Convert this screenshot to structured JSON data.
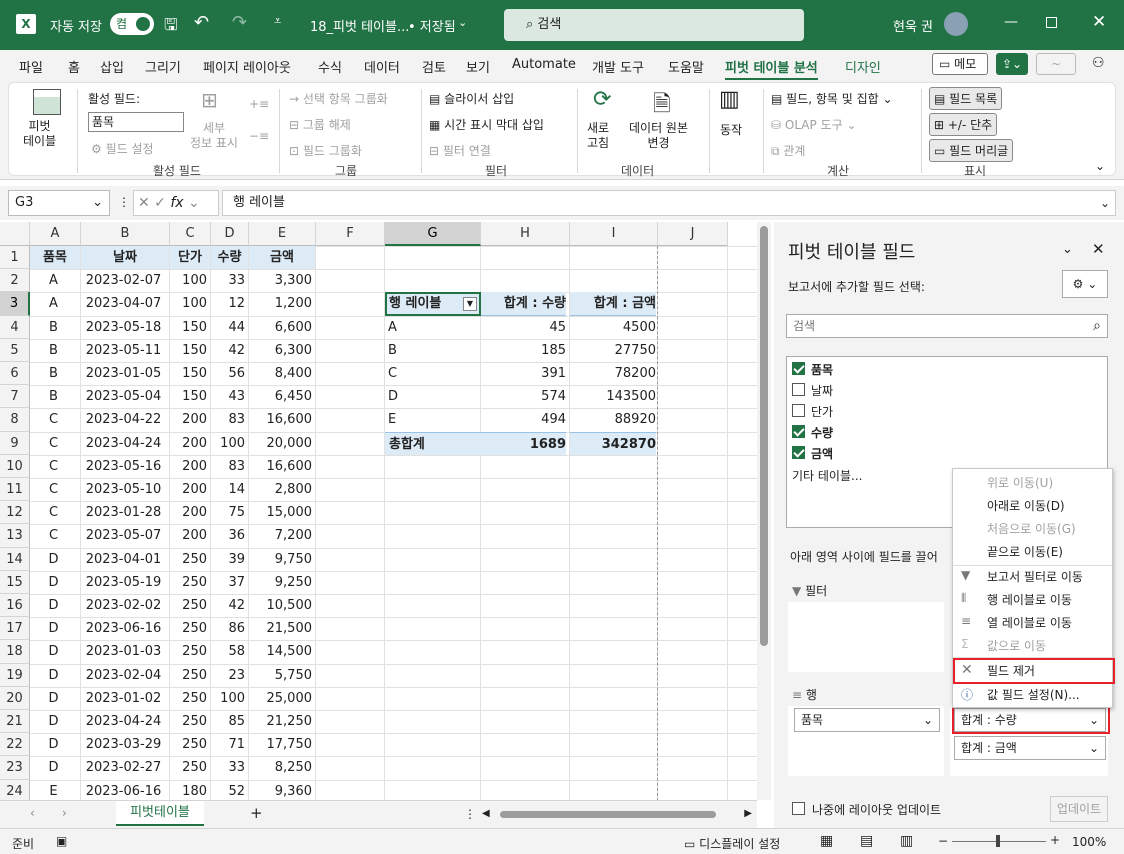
{
  "titlebar": {
    "autosave": "자동 저장",
    "toggle": "켬",
    "filename": "18_피벗 테이블...",
    "saved": "• 저장됨",
    "search": "검색",
    "user": "현욱 권"
  },
  "tabs": [
    "파일",
    "홈",
    "삽입",
    "그리기",
    "페이지 레이아웃",
    "수식",
    "데이터",
    "검토",
    "보기",
    "Automate",
    "개발 도구",
    "도움말",
    "피벗 테이블 분석",
    "디자인"
  ],
  "tab_right": {
    "memo": "메모"
  },
  "ribbon": {
    "pivot_table": "피벗\n테이블",
    "active_field_label": "활성 필드:",
    "active_field_value": "품목",
    "field_settings": "필드 설정",
    "detail": "세부\n정보 표시",
    "group_active": "활성 필드",
    "group_selection": "선택 항목 그룹화",
    "ungroup": "그룹 해제",
    "group_field": "필드 그룹화",
    "group_group": "그룹",
    "slicer": "슬라이서 삽입",
    "timeline": "시간 표시 막대 삽입",
    "filter_conn": "필터 연결",
    "group_filter": "필터",
    "refresh": "새로\n고침",
    "change_source": "데이터 원본\n변경",
    "group_data": "데이터",
    "actions": "동작",
    "fields_items": "필드, 항목 및 집합",
    "olap": "OLAP 도구",
    "relations": "관계",
    "group_calc": "계산",
    "field_list": "필드 목록",
    "plusminus": "+/- 단추",
    "field_headers": "필드 머리글",
    "group_show": "표시"
  },
  "formula": {
    "namebox": "G3",
    "content": "행 레이블"
  },
  "columns": [
    "A",
    "B",
    "C",
    "D",
    "E",
    "F",
    "G",
    "H",
    "I",
    "J"
  ],
  "rows": [
    "1",
    "2",
    "3",
    "4",
    "5",
    "6",
    "7",
    "8",
    "9",
    "10",
    "11",
    "12",
    "13",
    "14",
    "15",
    "16",
    "17",
    "18",
    "19",
    "20",
    "21",
    "22",
    "23",
    "24"
  ],
  "headers": [
    "품목",
    "날짜",
    "단가",
    "수량",
    "금액"
  ],
  "data": [
    [
      "A",
      "2023-02-07",
      "100",
      "33",
      "3,300"
    ],
    [
      "A",
      "2023-04-07",
      "100",
      "12",
      "1,200"
    ],
    [
      "B",
      "2023-05-18",
      "150",
      "44",
      "6,600"
    ],
    [
      "B",
      "2023-05-11",
      "150",
      "42",
      "6,300"
    ],
    [
      "B",
      "2023-01-05",
      "150",
      "56",
      "8,400"
    ],
    [
      "B",
      "2023-05-04",
      "150",
      "43",
      "6,450"
    ],
    [
      "C",
      "2023-04-22",
      "200",
      "83",
      "16,600"
    ],
    [
      "C",
      "2023-04-24",
      "200",
      "100",
      "20,000"
    ],
    [
      "C",
      "2023-05-16",
      "200",
      "83",
      "16,600"
    ],
    [
      "C",
      "2023-05-10",
      "200",
      "14",
      "2,800"
    ],
    [
      "C",
      "2023-01-28",
      "200",
      "75",
      "15,000"
    ],
    [
      "C",
      "2023-05-07",
      "200",
      "36",
      "7,200"
    ],
    [
      "D",
      "2023-04-01",
      "250",
      "39",
      "9,750"
    ],
    [
      "D",
      "2023-05-19",
      "250",
      "37",
      "9,250"
    ],
    [
      "D",
      "2023-02-02",
      "250",
      "42",
      "10,500"
    ],
    [
      "D",
      "2023-06-16",
      "250",
      "86",
      "21,500"
    ],
    [
      "D",
      "2023-01-03",
      "250",
      "58",
      "14,500"
    ],
    [
      "D",
      "2023-02-04",
      "250",
      "23",
      "5,750"
    ],
    [
      "D",
      "2023-01-02",
      "250",
      "100",
      "25,000"
    ],
    [
      "D",
      "2023-04-24",
      "250",
      "85",
      "21,250"
    ],
    [
      "D",
      "2023-03-29",
      "250",
      "71",
      "17,750"
    ],
    [
      "D",
      "2023-02-27",
      "250",
      "33",
      "8,250"
    ],
    [
      "E",
      "2023-06-16",
      "180",
      "52",
      "9,360"
    ]
  ],
  "pivot": {
    "h1": "행 레이블",
    "h2": "합계 : 수량",
    "h3": "합계 : 금액",
    "rows": [
      [
        "A",
        "45",
        "4500"
      ],
      [
        "B",
        "185",
        "27750"
      ],
      [
        "C",
        "391",
        "78200"
      ],
      [
        "D",
        "574",
        "143500"
      ],
      [
        "E",
        "494",
        "88920"
      ]
    ],
    "total": [
      "총합계",
      "1689",
      "342870"
    ]
  },
  "sheet": {
    "tab": "피벗테이블",
    "add": "+"
  },
  "status": {
    "ready": "준비",
    "display": "디스플레이 설정",
    "zoom": "100%"
  },
  "panel": {
    "title": "피벗 테이블 필드",
    "subtitle": "보고서에 추가할 필드 선택:",
    "search": "검색",
    "fields": [
      {
        "name": "품목",
        "checked": true
      },
      {
        "name": "날짜",
        "checked": false
      },
      {
        "name": "단가",
        "checked": false
      },
      {
        "name": "수량",
        "checked": true
      },
      {
        "name": "금액",
        "checked": true
      }
    ],
    "more": "기타 테이블...",
    "drag_hint": "아래 영역 사이에 필드를 끌어",
    "filter": "필터",
    "rows": "행",
    "row_field": "품목",
    "val1": "합계 : 수량",
    "val2": "합계 : 금액",
    "defer": "나중에 레이아웃 업데이트",
    "update": "업데이트"
  },
  "menu": [
    "위로 이동(U)",
    "아래로 이동(D)",
    "처음으로 이동(G)",
    "끝으로 이동(E)",
    "보고서 필터로 이동",
    "행 레이블로 이동",
    "열 레이블로 이동",
    "값으로 이동",
    "필드 제거",
    "값 필드 설정(N)..."
  ]
}
